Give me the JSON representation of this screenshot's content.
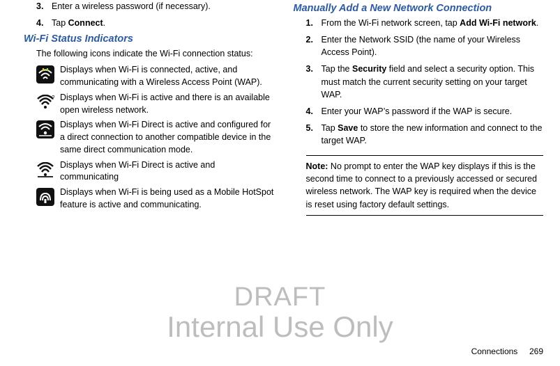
{
  "left": {
    "steps_a": [
      {
        "n": "3.",
        "text": "Enter a wireless password (if necessary)."
      },
      {
        "n": "4.",
        "prefix": "Tap ",
        "bold": "Connect",
        "suffix": "."
      }
    ],
    "heading": "Wi-Fi Status Indicators",
    "intro": "The following icons indicate the Wi-Fi connection status:",
    "icons": [
      {
        "name": "wifi-connected-icon",
        "desc": "Displays when Wi-Fi is connected, active, and communicating with a Wireless Access Point (WAP)."
      },
      {
        "name": "wifi-open-network-icon",
        "desc": "Displays when Wi-Fi is active and there is an available open wireless network."
      },
      {
        "name": "wifi-direct-configured-icon",
        "desc": "Displays when Wi-Fi Direct is active and configured for a direct connection to another compatible device in the same direct communication mode."
      },
      {
        "name": "wifi-direct-communicating-icon",
        "desc": "Displays when Wi-Fi Direct is active and communicating"
      },
      {
        "name": "wifi-hotspot-icon",
        "desc": "Displays when Wi-Fi is being used as a Mobile HotSpot feature is active and communicating."
      }
    ]
  },
  "right": {
    "heading": "Manually Add a New Network Connection",
    "steps": [
      {
        "n": "1.",
        "prefix": "From the Wi-Fi network screen, tap ",
        "bold": "Add Wi-Fi network",
        "suffix": "."
      },
      {
        "n": "2.",
        "text": "Enter the Network SSID (the name of your Wireless Access Point)."
      },
      {
        "n": "3.",
        "prefix": "Tap the ",
        "bold": "Security",
        "suffix": " field and select a security option. This must match the current security setting on your target WAP."
      },
      {
        "n": "4.",
        "text": "Enter your WAP’s password if the WAP is secure."
      },
      {
        "n": "5.",
        "prefix": "Tap ",
        "bold": "Save",
        "suffix": " to store the new information and connect to the target WAP."
      }
    ],
    "note_label": "Note:",
    "note_body": " No prompt to enter the WAP key displays if this is the second time to connect to a previously accessed or secured wireless network. The WAP key is required when the device is reset using factory default settings."
  },
  "watermark": {
    "l1": "DRAFT",
    "l2": "Internal Use Only"
  },
  "footer": {
    "section": "Connections",
    "page": "269"
  }
}
